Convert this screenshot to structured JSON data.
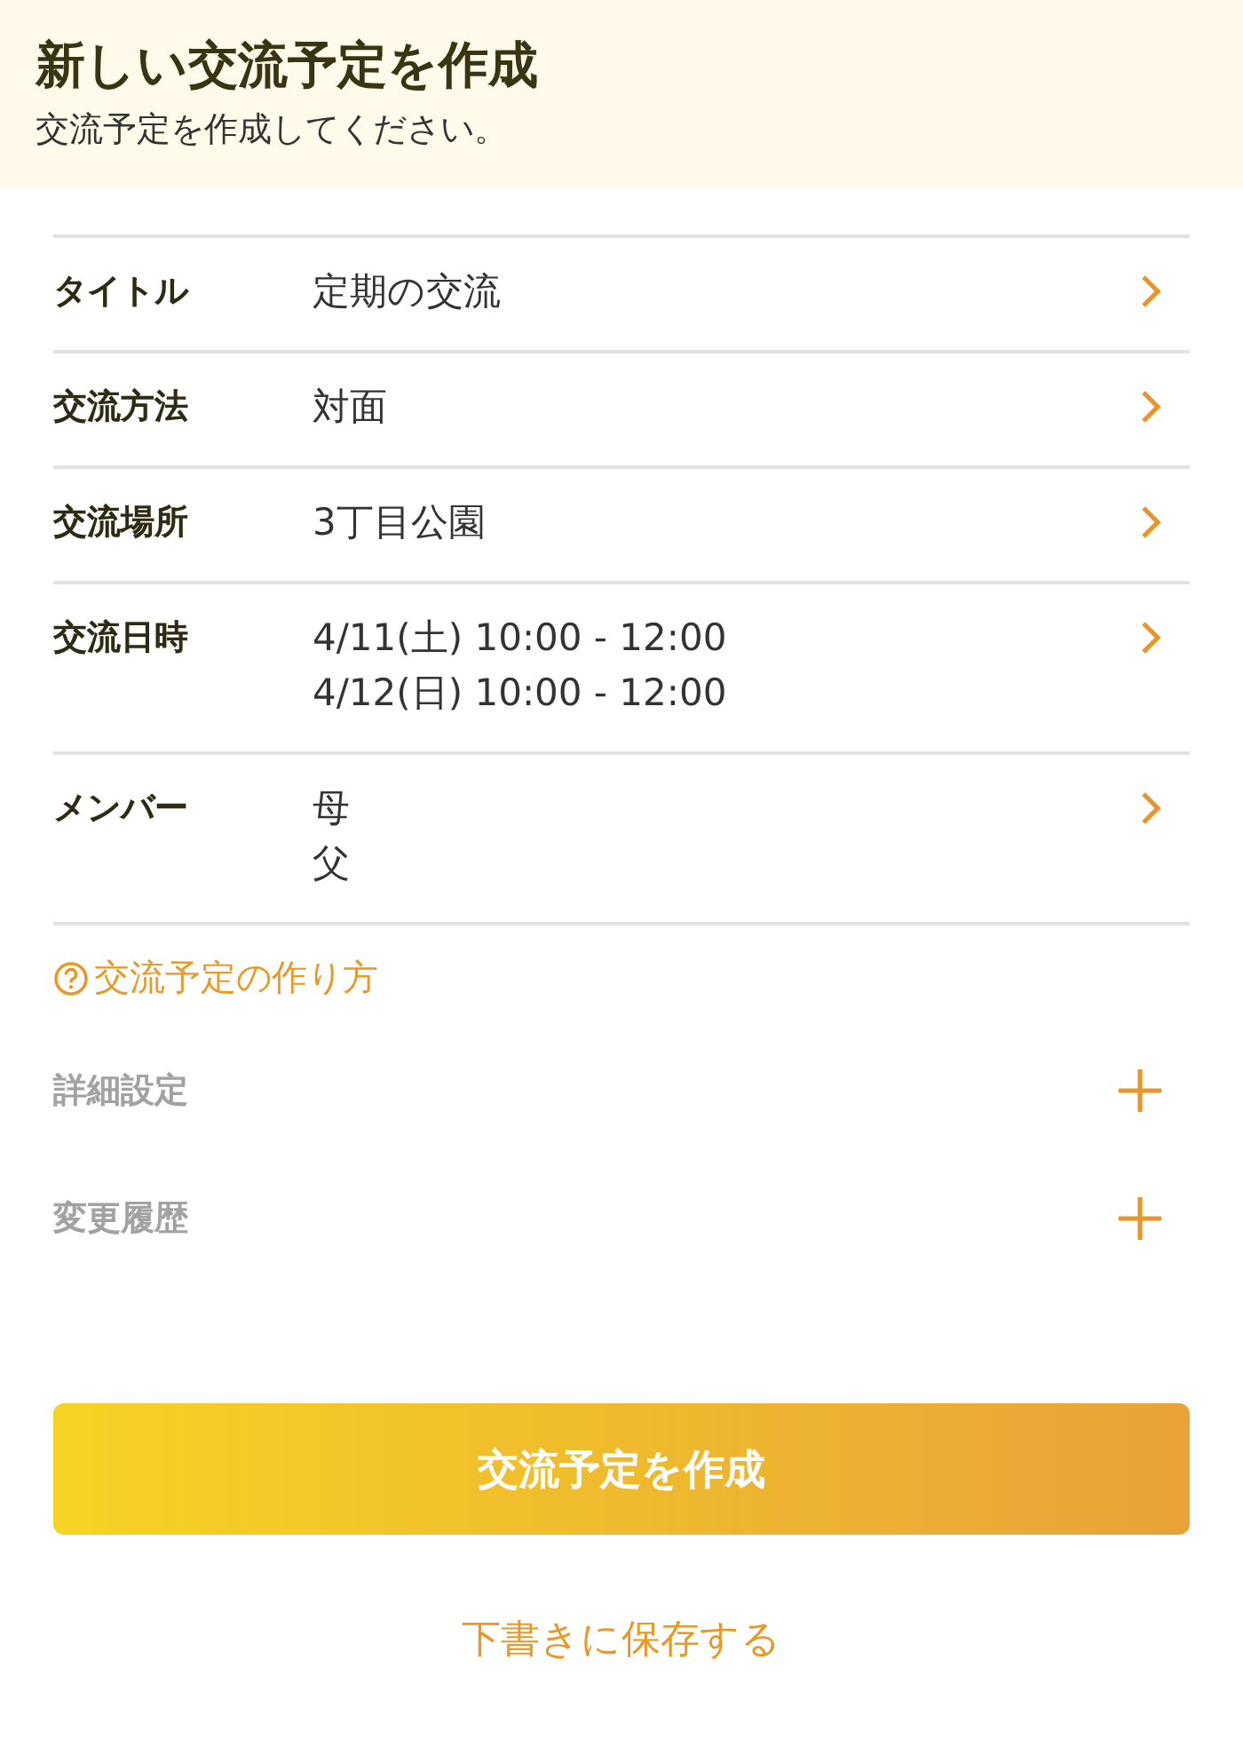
{
  "header": {
    "title": "新しい交流予定を作成",
    "subtitle": "交流予定を作成してください。"
  },
  "fields": [
    {
      "label": "タイトル",
      "lines": [
        "定期の交流"
      ]
    },
    {
      "label": "交流方法",
      "lines": [
        "対面"
      ]
    },
    {
      "label": "交流場所",
      "lines": [
        "3丁目公園"
      ]
    },
    {
      "label": "交流日時",
      "lines": [
        "4/11(土) 10:00 - 12:00",
        "4/12(日) 10:00 - 12:00"
      ]
    },
    {
      "label": "メンバー",
      "lines": [
        "母",
        "父"
      ]
    }
  ],
  "help_link": "交流予定の作り方",
  "sections": [
    {
      "label": "詳細設定",
      "expanded": false
    },
    {
      "label": "変更履歴",
      "expanded": false
    }
  ],
  "primary_button": "交流予定を作成",
  "secondary_link": "下書きに保存する"
}
